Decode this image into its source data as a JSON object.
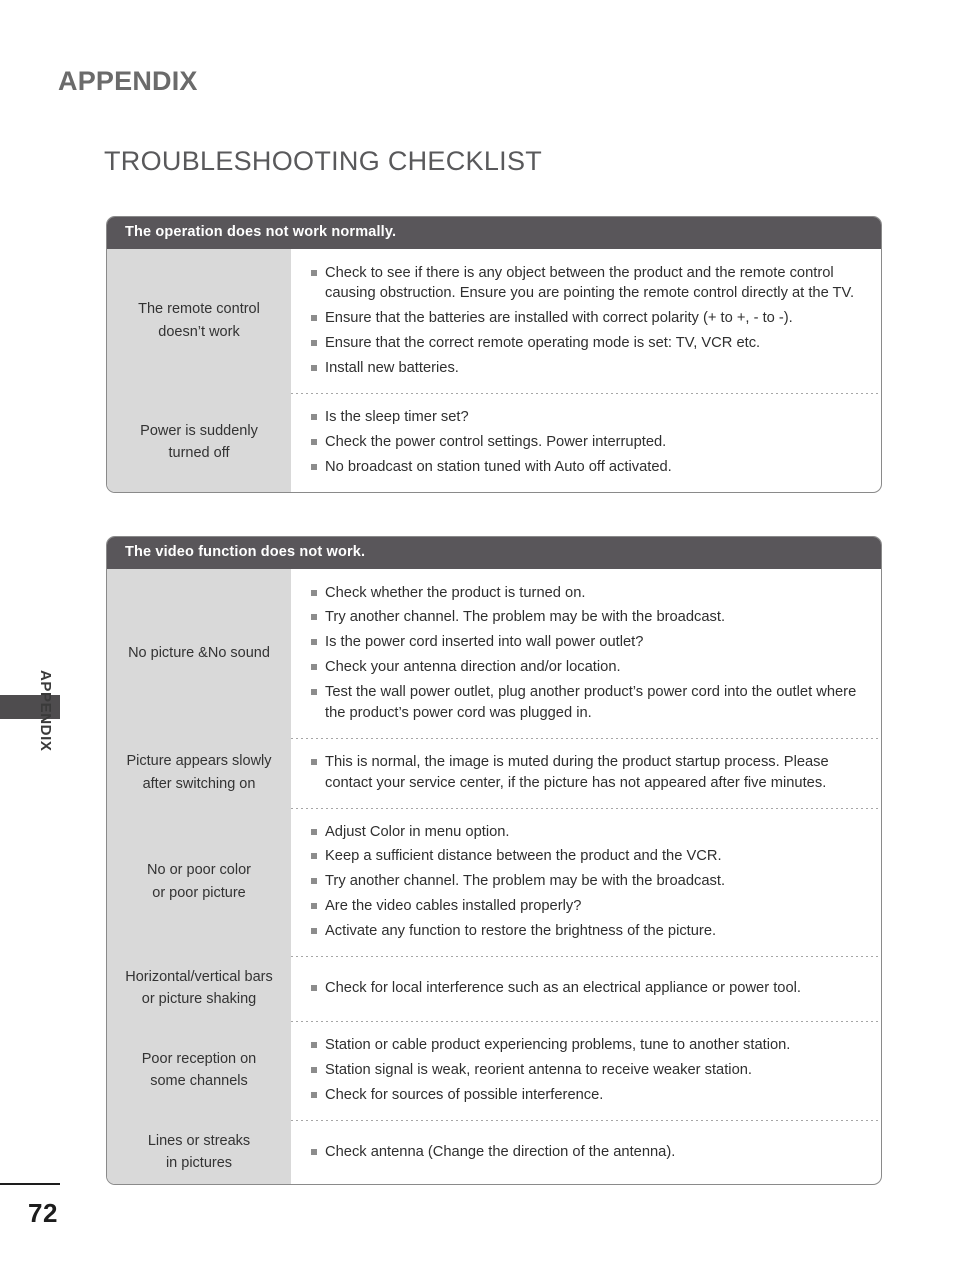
{
  "page": {
    "section_header": "APPENDIX",
    "title": "TROUBLESHOOTING CHECKLIST",
    "side_label": "APPENDIX",
    "number": "72"
  },
  "tables": [
    {
      "id": "table-1",
      "header": "The operation does not work normally.",
      "rows": [
        {
          "label_lines": [
            "The remote control",
            "doesn’t work"
          ],
          "items": [
            "Check to see if there is any object between the product and the remote control causing obstruction. Ensure you are pointing the remote control directly at the TV.",
            "Ensure that the batteries are installed with correct polarity (+ to +, - to -).",
            "Ensure that the correct remote operating mode is set: TV, VCR etc.",
            "Install new batteries."
          ]
        },
        {
          "label_lines": [
            "Power is suddenly",
            "turned off"
          ],
          "items": [
            "Is the sleep timer set?",
            "Check the power control settings. Power interrupted.",
            "No broadcast on station tuned with Auto off activated."
          ]
        }
      ]
    },
    {
      "id": "table-2",
      "header": "The video function does not work.",
      "rows": [
        {
          "label_lines": [
            "No picture &No sound"
          ],
          "items": [
            "Check whether the product is turned on.",
            "Try another channel. The problem may be with the broadcast.",
            "Is the power cord inserted into wall power outlet?",
            "Check your antenna direction and/or location.",
            "Test the wall power outlet, plug another product’s power cord into the outlet where the product’s power cord was plugged in."
          ]
        },
        {
          "label_lines": [
            "Picture appears slowly",
            "after switching on"
          ],
          "items": [
            "This is normal, the image is muted during the product startup process. Please contact your service center, if the picture has not appeared after five minutes."
          ]
        },
        {
          "label_lines": [
            "No or poor color",
            "or poor picture"
          ],
          "items": [
            "Adjust Color in menu option.",
            "Keep a sufficient distance between the product and the VCR.",
            "Try another channel. The problem may be with the broadcast.",
            "Are the video cables installed properly?",
            "Activate any function to restore the brightness of the picture."
          ]
        },
        {
          "label_lines": [
            "Horizontal/vertical bars",
            "or picture shaking"
          ],
          "items": [
            "Check for local interference such as an electrical appliance or power tool."
          ]
        },
        {
          "label_lines": [
            "Poor reception on",
            "some channels"
          ],
          "items": [
            "Station or cable product experiencing problems, tune to another station.",
            "Station signal is weak, reorient antenna to receive weaker station.",
            "Check for sources of possible interference."
          ]
        },
        {
          "label_lines": [
            "Lines or streaks",
            "in pictures"
          ],
          "items": [
            "Check antenna (Change the direction of the antenna)."
          ]
        }
      ]
    }
  ],
  "colors": {
    "header_bar": "#59565A",
    "label_cell": "#D9D9D9",
    "title_text": "#59595B",
    "side_tab": "#4E4C4E"
  }
}
